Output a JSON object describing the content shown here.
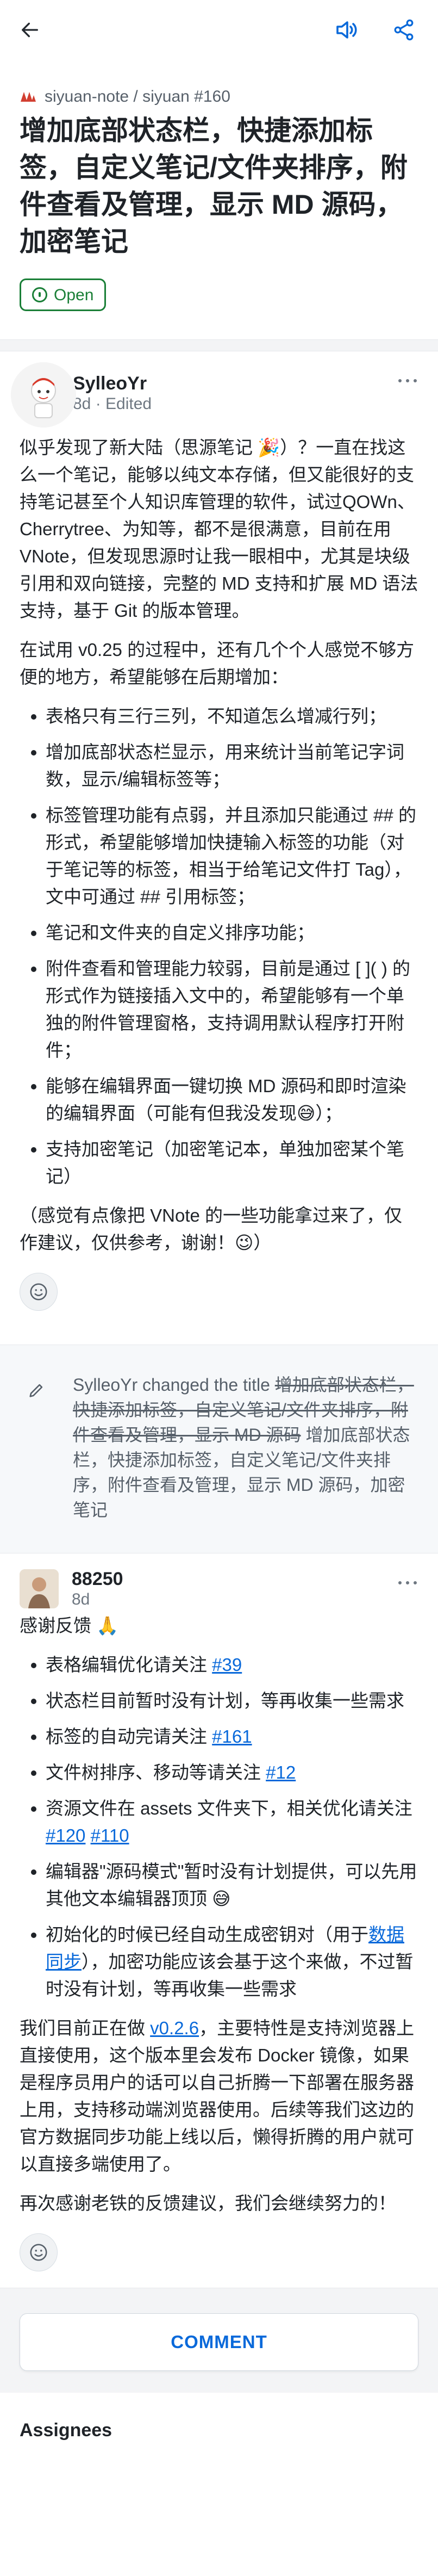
{
  "repo": {
    "path": "siyuan-note / siyuan #160"
  },
  "issue": {
    "title": "增加底部状态栏，快捷添加标签，自定义笔记/文件夹排序，附件查看及管理，显示 MD 源码，加密笔记",
    "state": "Open"
  },
  "comment1": {
    "author": "SylleoYr",
    "meta": "8d · Edited",
    "p1": "似乎发现了新大陆（思源笔记 🎉）？一直在找这么一个笔记，能够以纯文本存储，但又能很好的支持笔记甚至个人知识库管理的软件，试过QOWn、Cherrytree、为知等，都不是很满意，目前在用 VNote，但发现思源时让我一眼相中，尤其是块级引用和双向链接，完整的 MD 支持和扩展 MD 语法支持，基于 Git 的版本管理。",
    "p2": "在试用 v0.25 的过程中，还有几个个人感觉不够方便的地方，希望能够在后期增加：",
    "items": [
      "表格只有三行三列，不知道怎么增减行列；",
      "增加底部状态栏显示，用来统计当前笔记字词数，显示/编辑标签等；",
      "标签管理功能有点弱，并且添加只能通过 ## 的形式，希望能够增加快捷输入标签的功能（对于笔记等的标签，相当于给笔记文件打 Tag），文中可通过 ## 引用标签；",
      "笔记和文件夹的自定义排序功能；",
      "附件查看和管理能力较弱，目前是通过 [ ]( ) 的形式作为链接插入文中的，希望能够有一个单独的附件管理窗格，支持调用默认程序打开附件；",
      "能够在编辑界面一键切换 MD 源码和即时渲染的编辑界面（可能有但我没发现😅）；",
      "支持加密笔记（加密笔记本，单独加密某个笔记）"
    ],
    "p3": "（感觉有点像把 VNote 的一些功能拿过来了，仅作建议，仅供参考，谢谢！😉）"
  },
  "event": {
    "actor": "SylleoYr",
    "action": "changed the title",
    "old_title": "增加底部状态栏，快捷添加标签，自定义笔记/文件夹排序，附件查看及管理，显示 MD 源码",
    "new_title": "增加底部状态栏，快捷添加标签，自定义笔记/文件夹排序，附件查看及管理，显示 MD 源码，加密笔记"
  },
  "comment2": {
    "author": "88250",
    "meta": "8d",
    "intro": "感谢反馈 🙏",
    "items": [
      {
        "text": "表格编辑优化请关注 ",
        "links": [
          "#39"
        ],
        "tail": ""
      },
      {
        "text": "状态栏目前暂时没有计划，等再收集一些需求",
        "links": [],
        "tail": ""
      },
      {
        "text": "标签的自动完请关注 ",
        "links": [
          "#161"
        ],
        "tail": ""
      },
      {
        "text": "文件树排序、移动等请关注 ",
        "links": [
          "#12"
        ],
        "tail": ""
      },
      {
        "text": "资源文件在 assets 文件夹下，相关优化请关注 ",
        "links": [
          "#120",
          "#110"
        ],
        "tail": ""
      },
      {
        "text": "编辑器\"源码模式\"暂时没有计划提供，可以先用其他文本编辑器顶顶 😅",
        "links": [],
        "tail": ""
      },
      {
        "text": "初始化的时候已经自动生成密钥对（用于",
        "links": [
          "数据同步"
        ],
        "tail": "），加密功能应该会基于这个来做，不过暂时没有计划，等再收集一些需求"
      }
    ],
    "p1_pre": "我们目前正在做 ",
    "p1_link": "v0.2.6",
    "p1_post": "，主要特性是支持浏览器上直接使用，这个版本里会发布 Docker 镜像，如果是程序员用户的话可以自己折腾一下部署在服务器上用，支持移动端浏览器使用。后续等我们这边的官方数据同步功能上线以后，懒得折腾的用户就可以直接多端使用了。",
    "p2": "再次感谢老铁的反馈建议，我们会继续努力的！"
  },
  "actions": {
    "comment_button": "COMMENT"
  },
  "sidebar": {
    "assignees_label": "Assignees"
  },
  "colors": {
    "accent": "#0969da",
    "open": "#1a7f37",
    "muted": "#57606a"
  }
}
